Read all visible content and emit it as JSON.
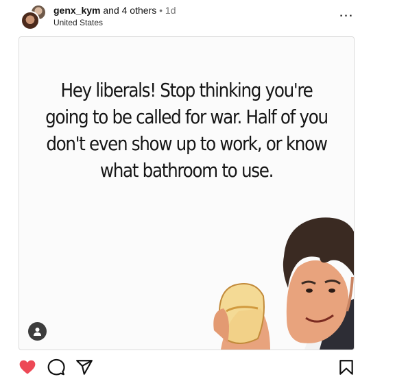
{
  "post": {
    "username": "genx_kym",
    "collab_text": " and 4 others",
    "separator": " • ",
    "time": "1d",
    "location": "United States",
    "more_label": "…"
  },
  "media": {
    "meme_text": "Hey liberals! Stop thinking you're going to be called for war. Half of you don't even show up to work, or know what bathroom to use."
  },
  "icons": {
    "like": "heart-icon",
    "comment": "comment-icon",
    "share": "share-icon",
    "save": "bookmark-icon",
    "tags": "user-tag-icon",
    "more": "more-icon"
  },
  "colors": {
    "like_active": "#ed4956",
    "muted": "#737373",
    "border": "#dbdbdb"
  }
}
